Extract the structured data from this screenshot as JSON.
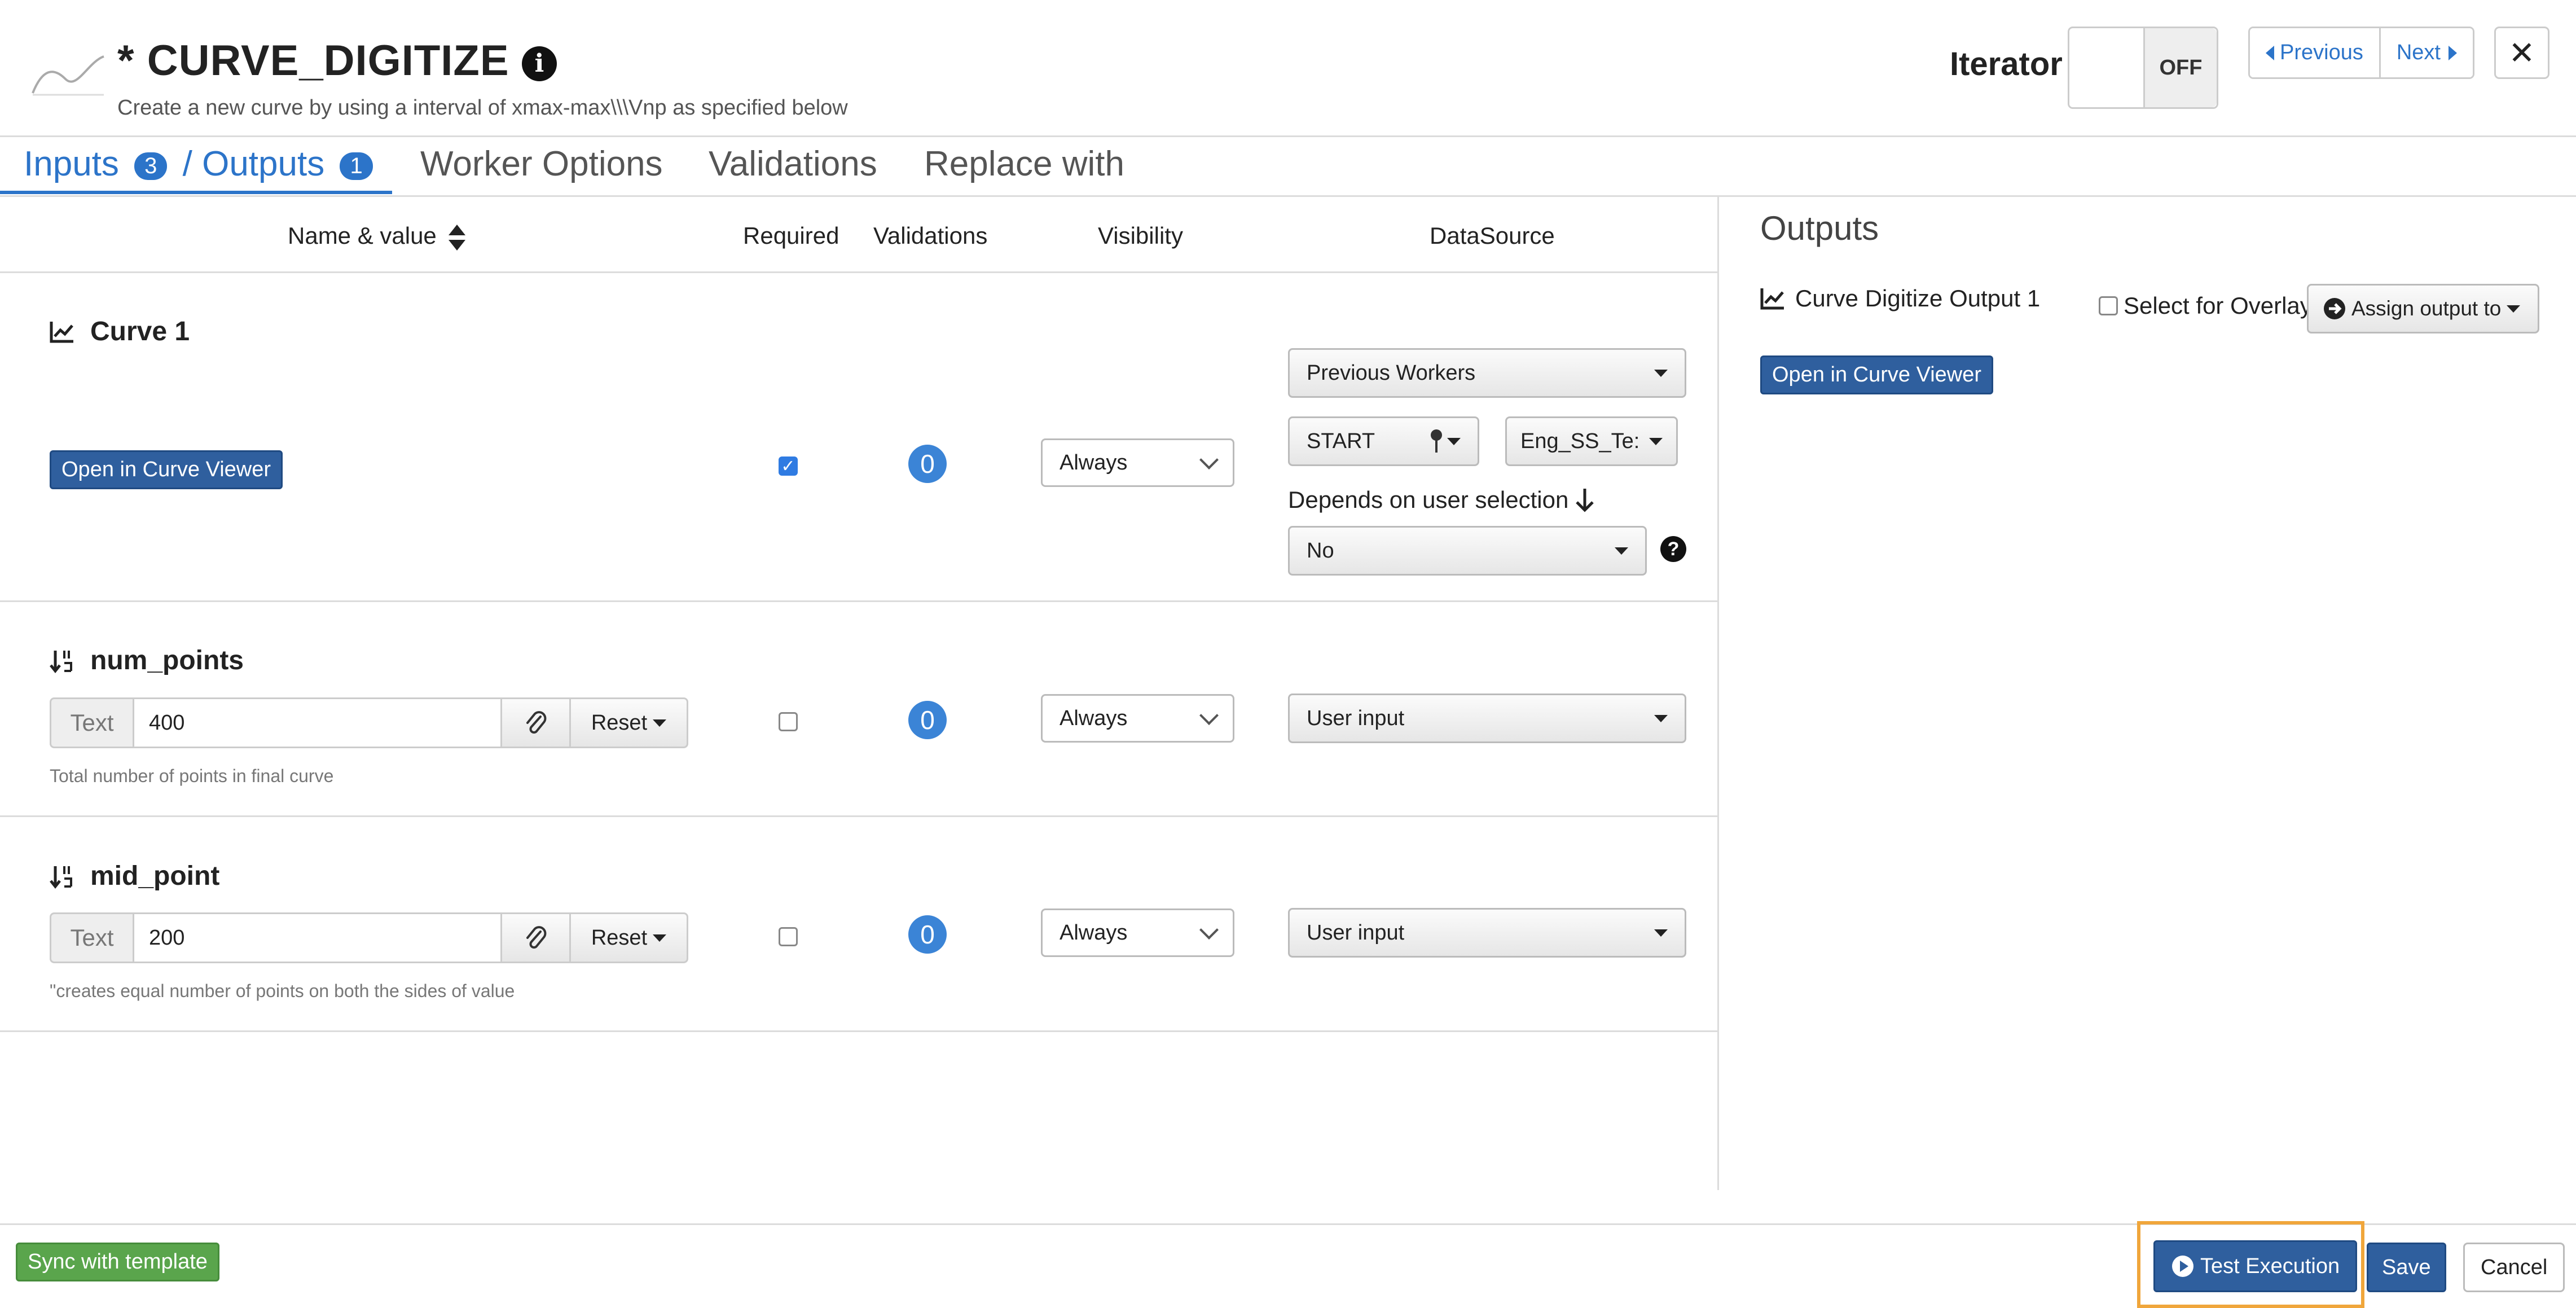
{
  "header": {
    "title": "* CURVE_DIGITIZE",
    "subtitle": "Create a new curve by using a interval of xmax-max\\\\\\Vnp as specified below",
    "iterator_label": "Iterator",
    "iterator_state": "OFF",
    "previous_label": "Previous",
    "next_label": "Next",
    "close_label": "✕"
  },
  "tabs": {
    "inputs_label": "Inputs",
    "inputs_count": "3",
    "separator": "/",
    "outputs_label": "Outputs",
    "outputs_count": "1",
    "worker_options": "Worker Options",
    "validations": "Validations",
    "replace_with": "Replace with"
  },
  "table_headers": {
    "name_value": "Name & value",
    "required": "Required",
    "validations": "Validations",
    "visibility": "Visibility",
    "datasource": "DataSource"
  },
  "rows": [
    {
      "name": "Curve 1",
      "button_label": "Open in Curve Viewer",
      "required": true,
      "validations_count": "0",
      "visibility": "Always",
      "datasource": "Previous Workers",
      "start_label": "START",
      "eng_label": "Eng_SS_Te:",
      "depends_label": "Depends on user selection",
      "depends_value": "No",
      "help_icon": "?"
    },
    {
      "name": "num_points",
      "addon": "Text",
      "value": "400",
      "reset_label": "Reset",
      "help": "Total number of points in final curve",
      "required": false,
      "validations_count": "0",
      "visibility": "Always",
      "datasource": "User input"
    },
    {
      "name": "mid_point",
      "addon": "Text",
      "value": "200",
      "reset_label": "Reset",
      "help": "\"creates equal number of points on both the sides of value",
      "required": false,
      "validations_count": "0",
      "visibility": "Always",
      "datasource": "User input"
    }
  ],
  "outputs": {
    "title": "Outputs",
    "item_label": "Curve Digitize Output 1",
    "overlay_label": "Select for Overlay",
    "assign_label": "Assign output to",
    "viewer_button": "Open in Curve Viewer"
  },
  "footer": {
    "sync_label": "Sync with template",
    "test_label": "Test Execution",
    "save_label": "Save",
    "cancel_label": "Cancel"
  },
  "colors": {
    "accent": "#2c74c9",
    "primary_button": "#2f5f9e",
    "success_button": "#5aa54c",
    "highlight": "#f0a63b"
  }
}
